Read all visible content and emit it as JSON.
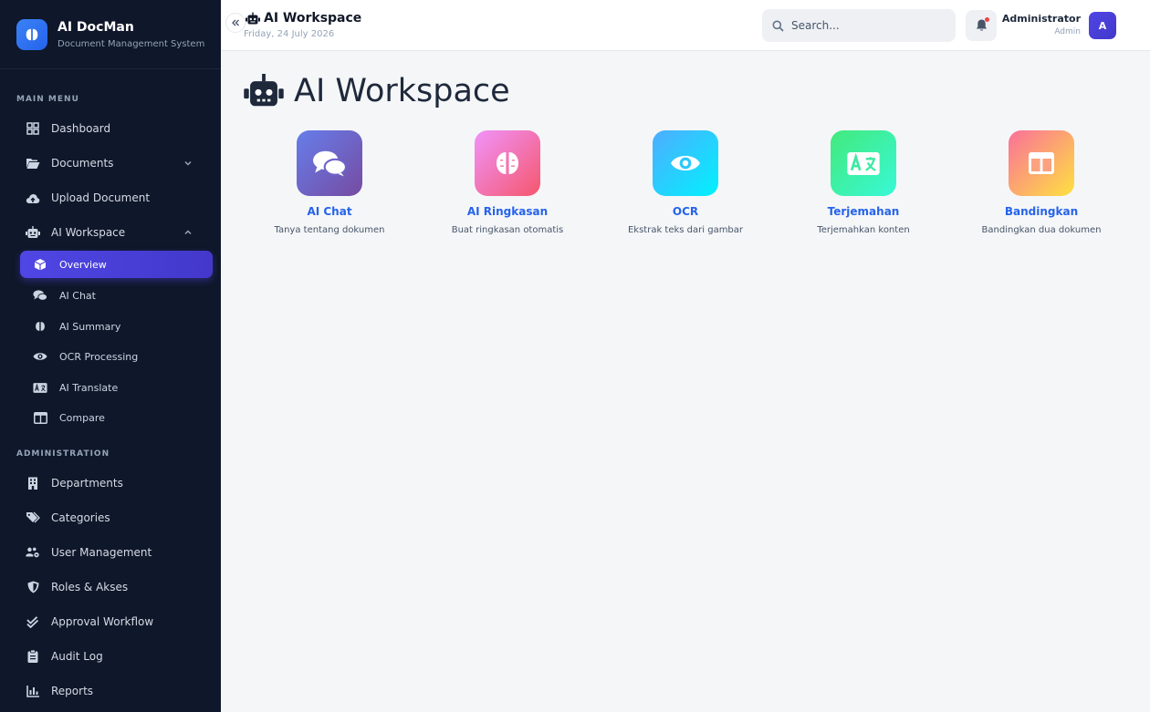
{
  "brand": {
    "name": "AI DocMan",
    "subtitle": "Document Management System"
  },
  "sidebar": {
    "main_title": "MAIN MENU",
    "admin_title": "ADMINISTRATION",
    "main_items": [
      {
        "label": "Dashboard",
        "icon": "dashboard-grid-icon"
      },
      {
        "label": "Documents",
        "icon": "folder-open-icon"
      },
      {
        "label": "Upload Document",
        "icon": "cloud-upload-icon"
      },
      {
        "label": "AI Workspace",
        "icon": "robot-icon"
      }
    ],
    "ai_sub_items": [
      {
        "label": "Overview",
        "icon": "cube-icon",
        "active": true
      },
      {
        "label": "AI Chat",
        "icon": "chat-bubbles-icon"
      },
      {
        "label": "AI Summary",
        "icon": "brain-icon"
      },
      {
        "label": "OCR Processing",
        "icon": "eye-icon"
      },
      {
        "label": "AI Translate",
        "icon": "language-icon"
      },
      {
        "label": "Compare",
        "icon": "columns-icon"
      }
    ],
    "admin_items": [
      {
        "label": "Departments",
        "icon": "building-icon"
      },
      {
        "label": "Categories",
        "icon": "tags-icon"
      },
      {
        "label": "User Management",
        "icon": "users-gear-icon"
      },
      {
        "label": "Roles & Akses",
        "icon": "shield-icon"
      },
      {
        "label": "Approval Workflow",
        "icon": "double-check-icon"
      },
      {
        "label": "Audit Log",
        "icon": "clipboard-icon"
      },
      {
        "label": "Reports",
        "icon": "chart-icon"
      }
    ]
  },
  "header": {
    "title": "AI Workspace",
    "date": "Friday, 24 July 2026",
    "search_placeholder": "Search...",
    "user_name": "Administrator",
    "user_role": "Admin",
    "avatar_initial": "A"
  },
  "main": {
    "title": "AI Workspace",
    "cards": [
      {
        "label": "AI Chat",
        "desc": "Tanya tentang dokumen",
        "icon": "chat-bubbles-icon",
        "gradient": [
          "#667eea",
          "#764ba2"
        ]
      },
      {
        "label": "AI Ringkasan",
        "desc": "Buat ringkasan otomatis",
        "icon": "brain-icon",
        "gradient": [
          "#f093fb",
          "#f5576c"
        ]
      },
      {
        "label": "OCR",
        "desc": "Ekstrak teks dari gambar",
        "icon": "eye-icon",
        "gradient": [
          "#4facfe",
          "#00f2fe"
        ]
      },
      {
        "label": "Terjemahan",
        "desc": "Terjemahkan konten",
        "icon": "language-icon",
        "gradient": [
          "#43e97b",
          "#38f9d7"
        ]
      },
      {
        "label": "Bandingkan",
        "desc": "Bandingkan dua dokumen",
        "icon": "columns-icon",
        "gradient": [
          "#fa709a",
          "#fee140"
        ]
      }
    ]
  }
}
